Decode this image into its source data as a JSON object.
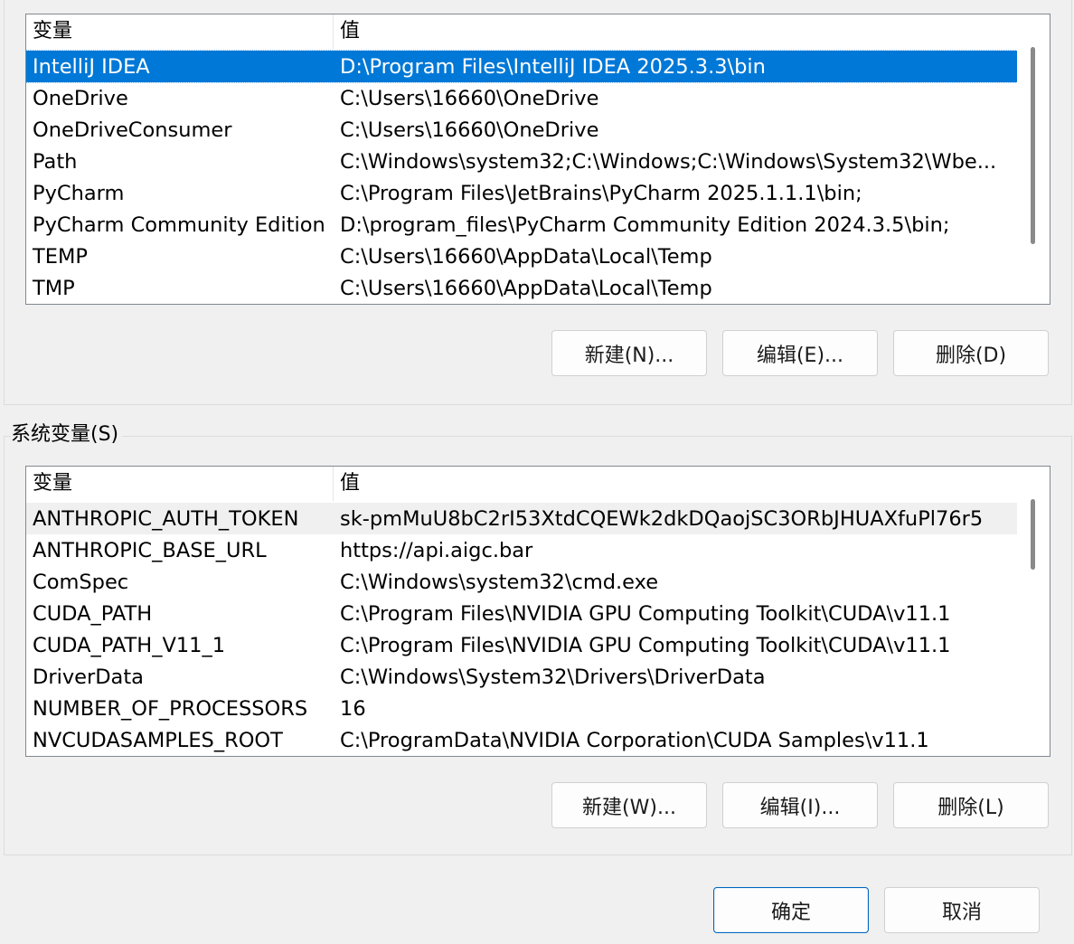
{
  "user_vars": {
    "header": {
      "col_name": "变量",
      "col_value": "值"
    },
    "rows": [
      {
        "name": "IntelliJ IDEA",
        "value": "D:\\Program Files\\IntelliJ IDEA 2025.3.3\\bin"
      },
      {
        "name": "OneDrive",
        "value": "C:\\Users\\16660\\OneDrive"
      },
      {
        "name": "OneDriveConsumer",
        "value": "C:\\Users\\16660\\OneDrive"
      },
      {
        "name": "Path",
        "value": "C:\\Windows\\system32;C:\\Windows;C:\\Windows\\System32\\Wbe..."
      },
      {
        "name": "PyCharm",
        "value": "C:\\Program Files\\JetBrains\\PyCharm 2025.1.1.1\\bin;"
      },
      {
        "name": "PyCharm Community Edition",
        "value": "D:\\program_files\\PyCharm Community Edition 2024.3.5\\bin;"
      },
      {
        "name": "TEMP",
        "value": "C:\\Users\\16660\\AppData\\Local\\Temp"
      },
      {
        "name": "TMP",
        "value": "C:\\Users\\16660\\AppData\\Local\\Temp"
      }
    ],
    "buttons": {
      "new": "新建(N)...",
      "edit": "编辑(E)...",
      "delete": "删除(D)"
    }
  },
  "system_vars": {
    "group_label": "系统变量(S)",
    "header": {
      "col_name": "变量",
      "col_value": "值"
    },
    "rows": [
      {
        "name": "ANTHROPIC_AUTH_TOKEN",
        "value": "sk-pmMuU8bC2rI53XtdCQEWk2dkDQaojSC3ORbJHUAXfuPl76r5"
      },
      {
        "name": "ANTHROPIC_BASE_URL",
        "value": "https://api.aigc.bar"
      },
      {
        "name": "ComSpec",
        "value": "C:\\Windows\\system32\\cmd.exe"
      },
      {
        "name": "CUDA_PATH",
        "value": "C:\\Program Files\\NVIDIA GPU Computing Toolkit\\CUDA\\v11.1"
      },
      {
        "name": "CUDA_PATH_V11_1",
        "value": "C:\\Program Files\\NVIDIA GPU Computing Toolkit\\CUDA\\v11.1"
      },
      {
        "name": "DriverData",
        "value": "C:\\Windows\\System32\\Drivers\\DriverData"
      },
      {
        "name": "NUMBER_OF_PROCESSORS",
        "value": "16"
      },
      {
        "name": "NVCUDASAMPLES_ROOT",
        "value": "C:\\ProgramData\\NVIDIA Corporation\\CUDA Samples\\v11.1"
      }
    ],
    "buttons": {
      "new": "新建(W)...",
      "edit": "编辑(I)...",
      "delete": "删除(L)"
    }
  },
  "dialog_buttons": {
    "ok": "确定",
    "cancel": "取消"
  },
  "colors": {
    "selection": "#0078d7",
    "primary_border": "#0067c0"
  }
}
